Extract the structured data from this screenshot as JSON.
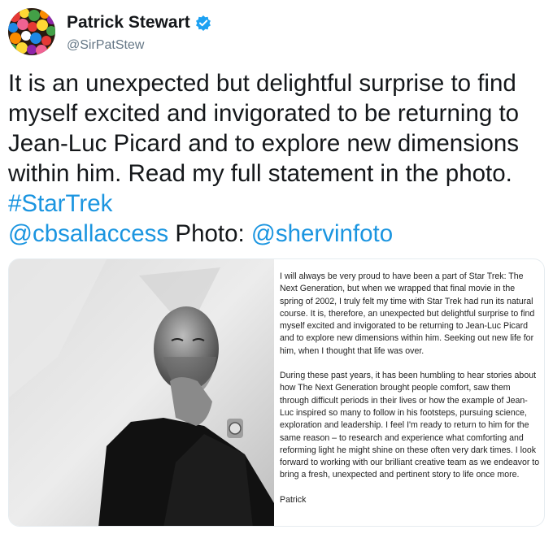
{
  "author": {
    "display_name": "Patrick Stewart",
    "handle": "@SirPatStew",
    "verified": true,
    "avatar_icon": "colorful-gumballs-avatar"
  },
  "tweet": {
    "text_plain": "It is an unexpected but delightful surprise to find myself excited and invigorated to be returning to Jean-Luc Picard and to explore new dimensions within him. Read my full statement in the photo.",
    "hashtag": "#StarTrek",
    "mention_1": "@cbsallaccess",
    "photo_credit_label": "Photo:",
    "mention_2": "@shervinfoto"
  },
  "media": {
    "photo_icon": "black-and-white-portrait",
    "statement": {
      "paragraph_1": "I will always be very proud to have been a part of Star Trek: The Next Generation, but when we wrapped that final movie in the spring of 2002, I truly felt my time with Star Trek had run its natural course.  It is, therefore, an unexpected but delightful surprise to find myself excited and invigorated to be returning to Jean-Luc Picard and to explore new dimensions within him. Seeking out new life for him, when I thought that life was over.",
      "paragraph_2": "During these past years, it has been humbling to hear stories about how The Next Generation brought people comfort, saw them through difficult periods in their lives or how the example of Jean-Luc inspired so many to follow in his footsteps, pursuing science, exploration and leadership. I feel I'm ready to return to him for the same reason – to research and experience what comforting and reforming light he might shine on these often very dark times.  I look forward to working with our brilliant creative team as we endeavor to bring a fresh, unexpected and pertinent story to life once more.",
      "signature": "Patrick"
    }
  },
  "colors": {
    "link": "#1b95e0",
    "text": "#14171a",
    "handle": "#657786",
    "verified_badge": "#1da1f2"
  }
}
